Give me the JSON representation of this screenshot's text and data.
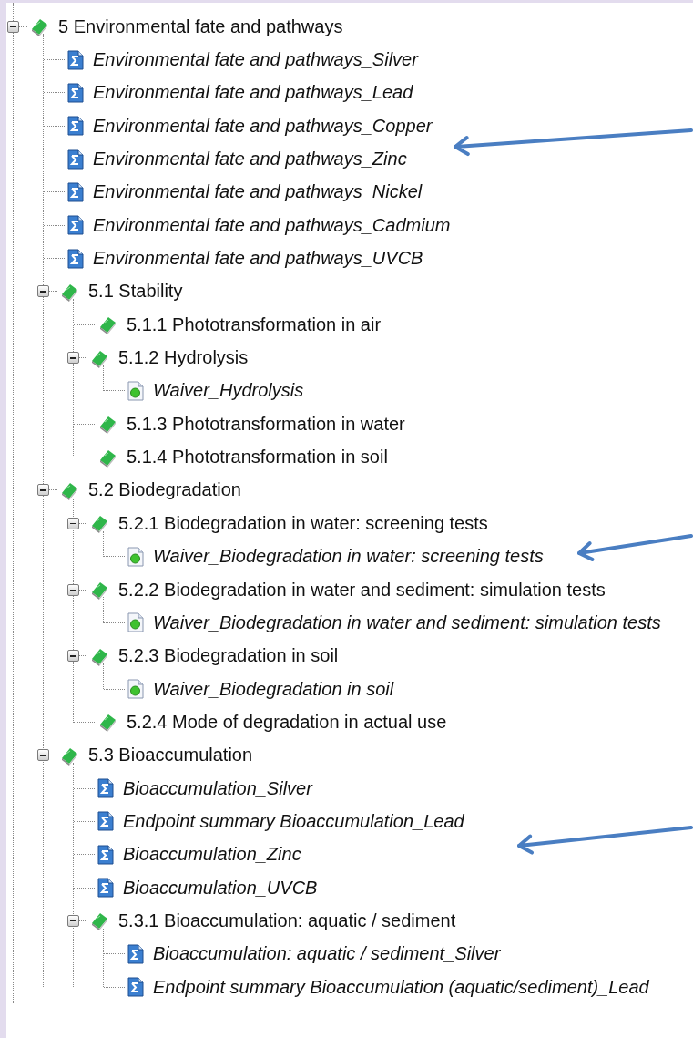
{
  "tree": [
    {
      "kind": "folder",
      "label": "5 Environmental fate and pathways",
      "expanded": true,
      "children": [
        {
          "kind": "summary",
          "label": "Environmental fate and pathways_Silver"
        },
        {
          "kind": "summary",
          "label": "Environmental fate and pathways_Lead"
        },
        {
          "kind": "summary",
          "label": "Environmental fate and pathways_Copper"
        },
        {
          "kind": "summary",
          "label": "Environmental fate and pathways_Zinc"
        },
        {
          "kind": "summary",
          "label": "Environmental fate and pathways_Nickel"
        },
        {
          "kind": "summary",
          "label": "Environmental fate and pathways_Cadmium"
        },
        {
          "kind": "summary",
          "label": "Environmental fate and pathways_UVCB"
        },
        {
          "kind": "folder",
          "label": "5.1 Stability",
          "expanded": true,
          "children": [
            {
              "kind": "book",
              "label": "5.1.1 Phototransformation in air"
            },
            {
              "kind": "folder",
              "label": "5.1.2 Hydrolysis",
              "expanded": true,
              "children": [
                {
                  "kind": "waiver",
                  "label": "Waiver_Hydrolysis"
                }
              ]
            },
            {
              "kind": "book",
              "label": "5.1.3 Phototransformation in water"
            },
            {
              "kind": "book",
              "label": "5.1.4 Phototransformation in soil"
            }
          ]
        },
        {
          "kind": "folder",
          "label": "5.2 Biodegradation",
          "expanded": true,
          "children": [
            {
              "kind": "folder",
              "label": "5.2.1 Biodegradation in water: screening tests",
              "expanded": true,
              "children": [
                {
                  "kind": "waiver",
                  "label": "Waiver_Biodegradation in water: screening tests"
                }
              ]
            },
            {
              "kind": "folder",
              "label": "5.2.2 Biodegradation in water and sediment: simulation tests",
              "expanded": true,
              "children": [
                {
                  "kind": "waiver",
                  "label": "Waiver_Biodegradation in water and sediment: simulation tests"
                }
              ]
            },
            {
              "kind": "folder",
              "label": "5.2.3 Biodegradation in soil",
              "expanded": true,
              "children": [
                {
                  "kind": "waiver",
                  "label": "Waiver_Biodegradation in soil"
                }
              ]
            },
            {
              "kind": "book",
              "label": "5.2.4 Mode of degradation in actual use"
            }
          ]
        },
        {
          "kind": "folder",
          "label": "5.3 Bioaccumulation",
          "expanded": true,
          "children": [
            {
              "kind": "summary",
              "label": "Bioaccumulation_Silver"
            },
            {
              "kind": "summary",
              "label": "Endpoint summary Bioaccumulation_Lead"
            },
            {
              "kind": "summary",
              "label": "Bioaccumulation_Zinc"
            },
            {
              "kind": "summary",
              "label": "Bioaccumulation_UVCB"
            },
            {
              "kind": "folder",
              "label": "5.3.1 Bioaccumulation: aquatic / sediment",
              "expanded": true,
              "children": [
                {
                  "kind": "summary",
                  "label": "Bioaccumulation: aquatic / sediment_Silver"
                },
                {
                  "kind": "summary",
                  "label": "Endpoint summary Bioaccumulation (aquatic/sediment)_Lead"
                }
              ]
            }
          ]
        }
      ]
    }
  ],
  "arrows": [
    {
      "kind": "arrow"
    },
    {
      "kind": "arrow"
    },
    {
      "kind": "arrow"
    }
  ]
}
